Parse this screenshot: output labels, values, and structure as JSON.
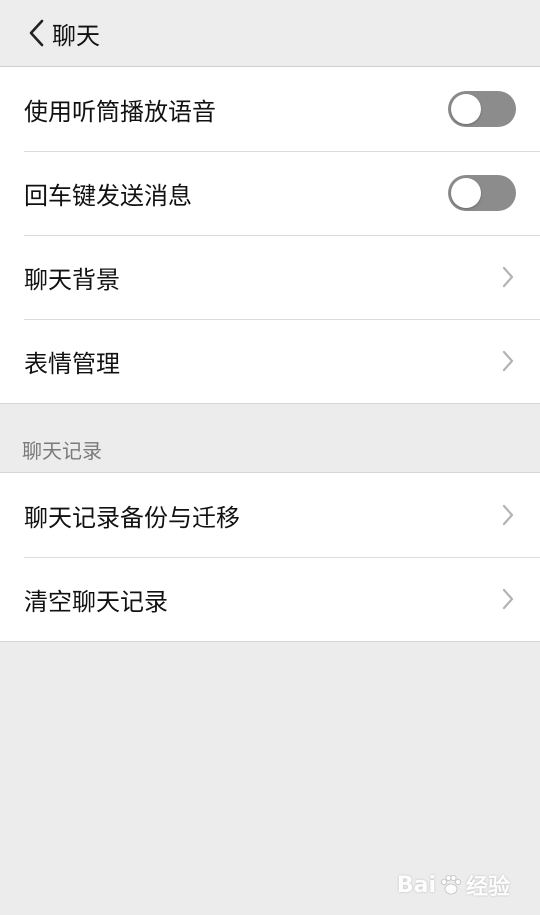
{
  "header": {
    "title": "聊天"
  },
  "settings": {
    "items": [
      {
        "label": "使用听筒播放语音",
        "type": "toggle",
        "on": false
      },
      {
        "label": "回车键发送消息",
        "type": "toggle",
        "on": false
      },
      {
        "label": "聊天背景",
        "type": "link"
      },
      {
        "label": "表情管理",
        "type": "link"
      }
    ]
  },
  "history": {
    "section_title": "聊天记录",
    "items": [
      {
        "label": "聊天记录备份与迁移",
        "type": "link"
      },
      {
        "label": "清空聊天记录",
        "type": "link"
      }
    ]
  },
  "watermark": {
    "left_text": "Bai",
    "right_text": "经验"
  },
  "colors": {
    "background": "#ececec",
    "card": "#ffffff",
    "toggle_off": "#8c8c8c",
    "chevron": "#b3b3b3",
    "section_title": "#7a7a7a"
  },
  "icons": {
    "back": "chevron-left-icon",
    "chevron": "chevron-right-icon",
    "watermark": "paw-icon"
  }
}
